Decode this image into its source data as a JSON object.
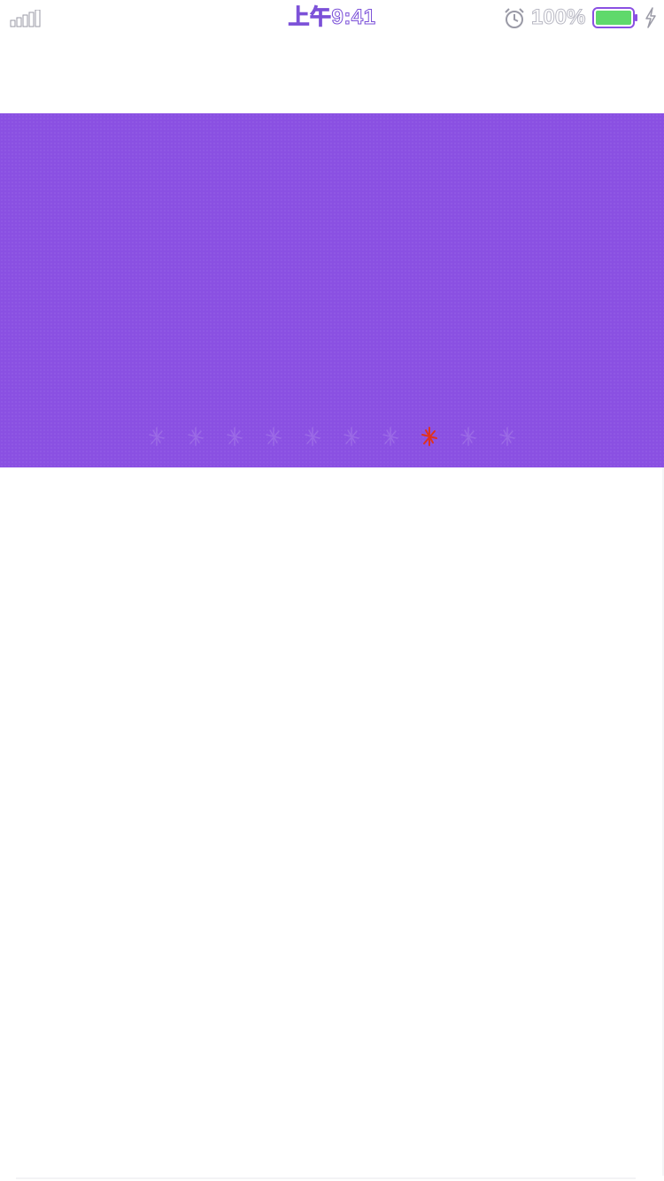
{
  "status_bar": {
    "time": "上午9:41",
    "battery_percent": "100%",
    "battery_level": 1.0,
    "battery_color": "#5fd96b",
    "icons": [
      "signal-icon",
      "alarm-icon",
      "battery-icon",
      "charging-icon"
    ]
  },
  "banner": {
    "background_color": "#8a50e2",
    "page_count": 10,
    "active_page": 8,
    "indicator_active_color": "#e0321e",
    "indicator_inactive_color": "#9b6ae6"
  }
}
